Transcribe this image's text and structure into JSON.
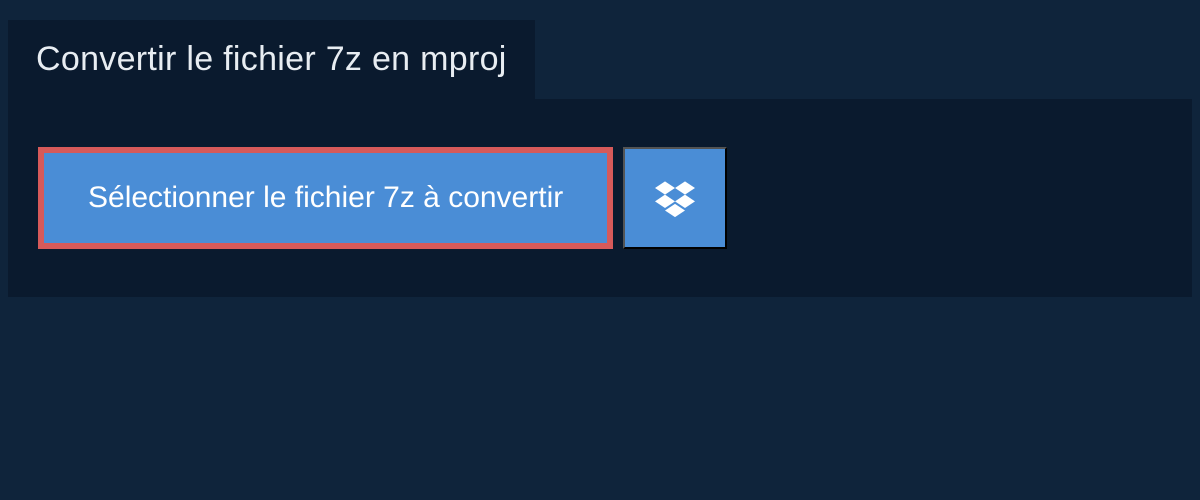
{
  "header": {
    "title": "Convertir le fichier 7z en mproj"
  },
  "upload": {
    "select_button_label": "Sélectionner le fichier 7z à convertir"
  }
}
